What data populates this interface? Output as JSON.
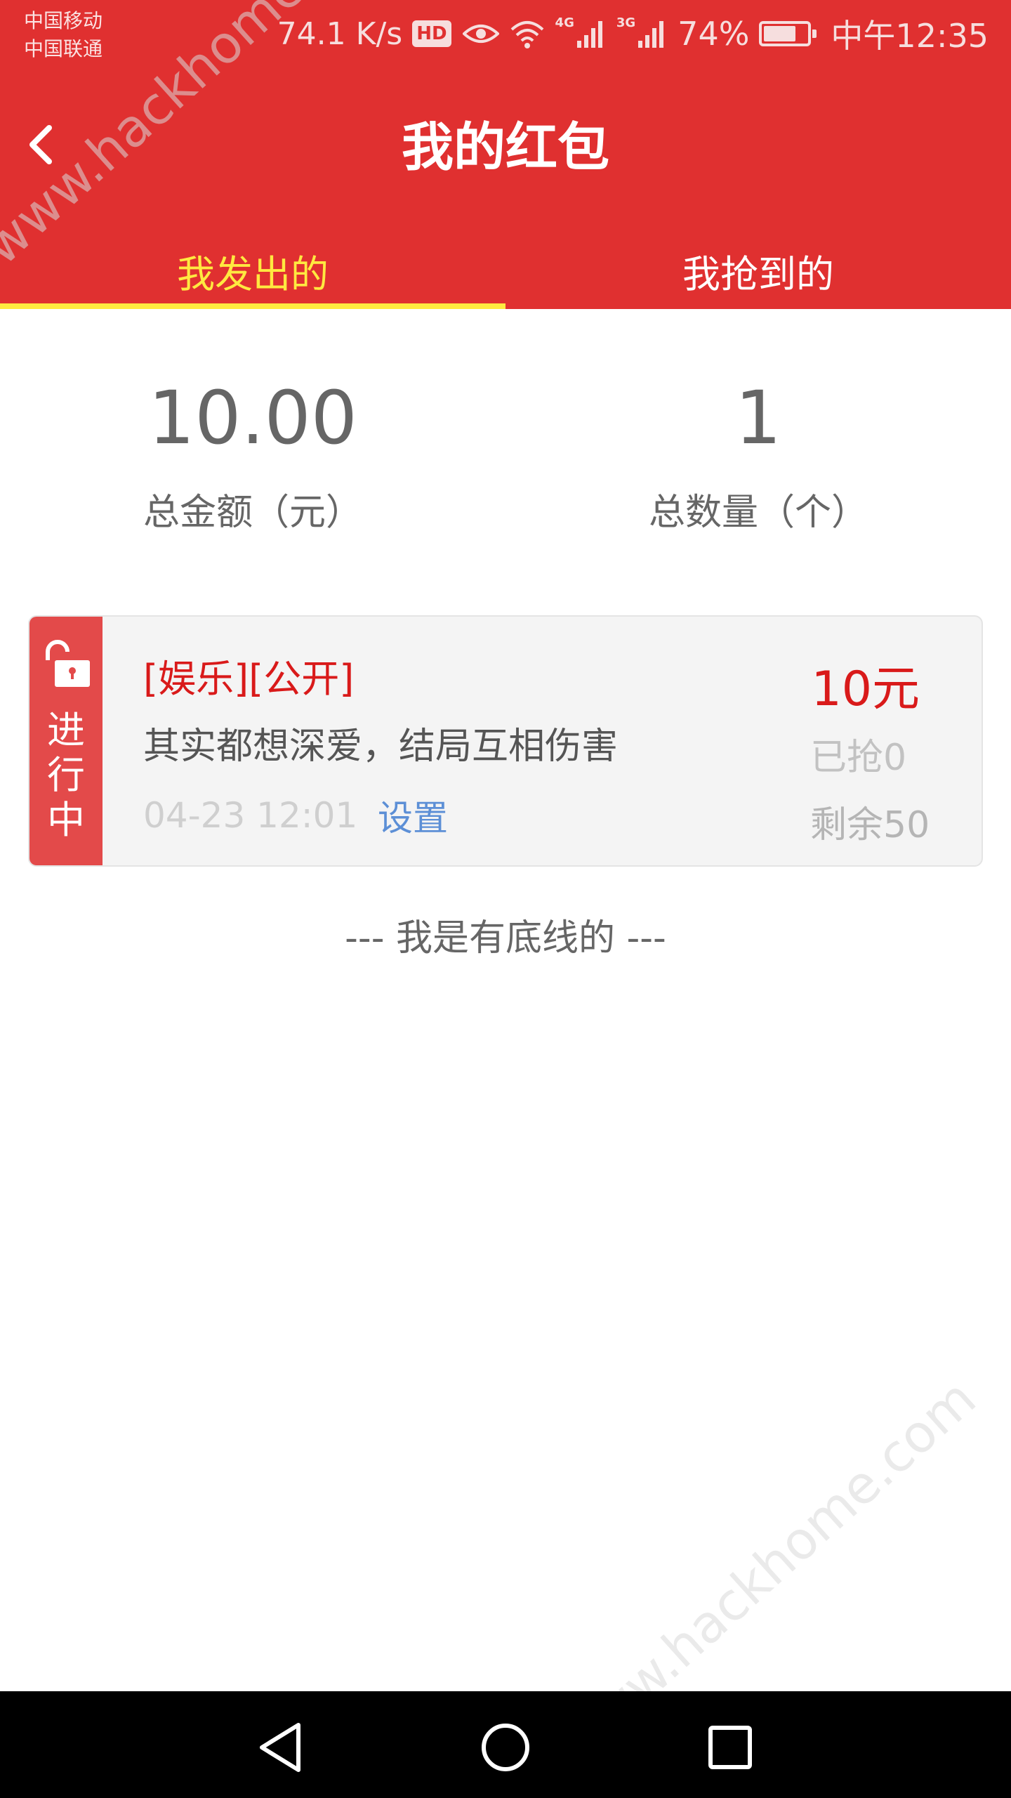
{
  "status_bar": {
    "carrier_1": "中国移动",
    "carrier_2": "中国联通",
    "net_speed": "74.1 K/s",
    "hd_badge": "HD",
    "signal_1_label": "4G",
    "signal_2_label": "3G",
    "battery_percent": "74%",
    "battery_level": 0.74,
    "time": "中午12:35"
  },
  "header": {
    "title": "我的红包",
    "background_color": "#e03030"
  },
  "tabs": [
    {
      "label": "我发出的",
      "active": true
    },
    {
      "label": "我抢到的",
      "active": false
    }
  ],
  "summary": {
    "total_amount_value": "10.00",
    "total_amount_label": "总金额（元）",
    "total_count_value": "1",
    "total_count_label": "总数量（个）"
  },
  "cards": [
    {
      "status": "进行中",
      "status_chars": [
        "进",
        "行",
        "中"
      ],
      "tags": "[娱乐][公开]",
      "description": "其实都想深爱，结局互相伤害",
      "date": "04-23 12:01",
      "settings_label": "设置",
      "amount": "10元",
      "grabbed": "已抢0",
      "remaining": "剩余50"
    }
  ],
  "footer_note": "--- 我是有底线的 ---",
  "watermark": "www.hackhome.com",
  "accent_colors": {
    "red": "#e03030",
    "tab_active": "#ffe940",
    "link_blue": "#5c8fd6"
  }
}
